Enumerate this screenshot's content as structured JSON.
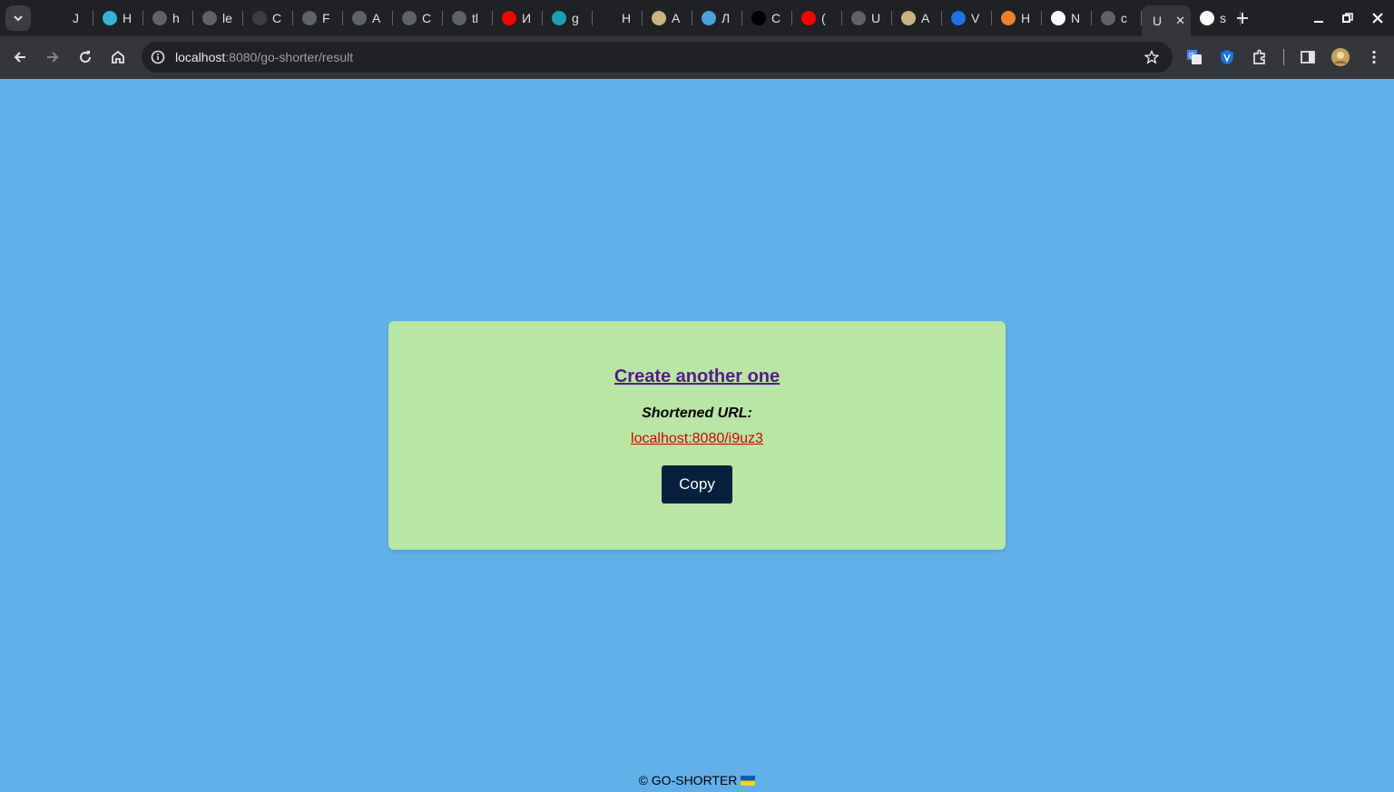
{
  "browser": {
    "tabs": [
      {
        "title": "J",
        "favicon": "blank-icon",
        "color": "#202124"
      },
      {
        "title": "H",
        "favicon": "feather-icon",
        "color": "#2fb6d8"
      },
      {
        "title": "h",
        "favicon": "github-icon",
        "color": "#5f6368"
      },
      {
        "title": "le",
        "favicon": "globe-icon",
        "color": "#5f6368"
      },
      {
        "title": "C",
        "favicon": "braces-icon",
        "color": "#3c3d41"
      },
      {
        "title": "F",
        "favicon": "globe-icon",
        "color": "#5f6368"
      },
      {
        "title": "A",
        "favicon": "globe-icon",
        "color": "#5f6368"
      },
      {
        "title": "C",
        "favicon": "globe-icon",
        "color": "#5f6368"
      },
      {
        "title": "tl",
        "favicon": "globe-icon",
        "color": "#5f6368"
      },
      {
        "title": "И",
        "favicon": "youtube-icon",
        "color": "#ff0000"
      },
      {
        "title": "g",
        "favicon": "teal-logo-icon",
        "color": "#17a2b8"
      },
      {
        "title": "H",
        "favicon": "blank-icon",
        "color": "#202124"
      },
      {
        "title": "A",
        "favicon": "question-icon",
        "color": "#c9b37e"
      },
      {
        "title": "Л",
        "favicon": "snowflake-icon",
        "color": "#4aa3df"
      },
      {
        "title": "C",
        "favicon": "dev-icon",
        "color": "#000000"
      },
      {
        "title": "(",
        "favicon": "youtube-icon",
        "color": "#ff0000"
      },
      {
        "title": "U",
        "favicon": "globe-icon",
        "color": "#5f6368"
      },
      {
        "title": "A",
        "favicon": "question-icon",
        "color": "#c9b37e"
      },
      {
        "title": "V",
        "favicon": "circle-logo-icon",
        "color": "#1a73e8"
      },
      {
        "title": "H",
        "favicon": "stack-icon",
        "color": "#f48024"
      },
      {
        "title": "N",
        "favicon": "medium-icon",
        "color": "#ffffff"
      },
      {
        "title": "c",
        "favicon": "github-icon",
        "color": "#5f6368"
      },
      {
        "title": "U",
        "favicon": "none",
        "color": "#35363a",
        "active": true
      },
      {
        "title": "s",
        "favicon": "google-icon",
        "color": "#ffffff"
      }
    ],
    "url_host": "localhost",
    "url_path": ":8080/go-shorter/result"
  },
  "page": {
    "create_link": "Create another one",
    "short_label": "Shortened URL:",
    "short_url": "localhost:8080/i9uz3",
    "copy_button": "Copy",
    "footer_text": "© GO-SHORTER"
  },
  "colors": {
    "page_bg": "#62b0e8",
    "card_bg": "#b8e6a3",
    "link_visited": "#551a8b",
    "short_url": "#d40000",
    "button_bg": "#062140"
  }
}
